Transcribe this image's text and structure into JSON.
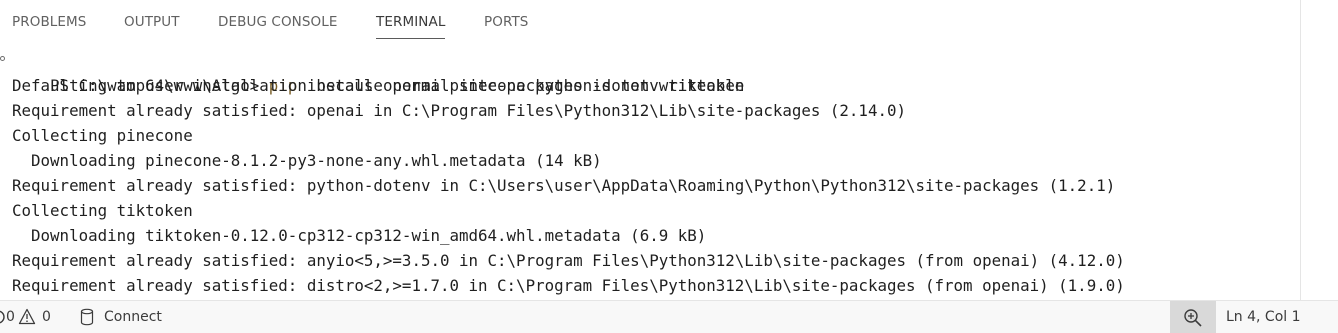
{
  "panel": {
    "tabs": [
      {
        "label": "PROBLEMS",
        "active": false
      },
      {
        "label": "OUTPUT",
        "active": false
      },
      {
        "label": "DEBUG CONSOLE",
        "active": false
      },
      {
        "label": "TERMINAL",
        "active": true
      },
      {
        "label": "PORTS",
        "active": false
      }
    ]
  },
  "terminal": {
    "prompt": "PS C:\\wamp64\\www\\Algo> ",
    "command_name": "pip",
    "command_args": " install openai pinecone python-dotenv tiktoken",
    "output": [
      "Defaulting to user installation because normal site-packages is not writeable",
      "Requirement already satisfied: openai in C:\\Program Files\\Python312\\Lib\\site-packages (2.14.0)",
      "Collecting pinecone",
      "  Downloading pinecone-8.1.2-py3-none-any.whl.metadata (14 kB)",
      "Requirement already satisfied: python-dotenv in C:\\Users\\user\\AppData\\Roaming\\Python\\Python312\\site-packages (1.2.1)",
      "Collecting tiktoken",
      "  Downloading tiktoken-0.12.0-cp312-cp312-win_amd64.whl.metadata (6.9 kB)",
      "Requirement already satisfied: anyio<5,>=3.5.0 in C:\\Program Files\\Python312\\Lib\\site-packages (from openai) (4.12.0)",
      "Requirement already satisfied: distro<2,>=1.7.0 in C:\\Program Files\\Python312\\Lib\\site-packages (from openai) (1.9.0)"
    ]
  },
  "status_bar": {
    "errors_count": "0",
    "warnings_count": "0",
    "connect_label": "Connect",
    "cursor_position": "Ln 4, Col 1",
    "icons": {
      "errors": "error-circle-icon",
      "warnings": "warning-triangle-icon",
      "connect": "database-icon",
      "zoom": "zoom-in-icon"
    }
  },
  "colors": {
    "command_highlight": "#795e26",
    "text": "#1f1f1f",
    "tab_inactive": "#616161",
    "status_bg": "#f8f8f8",
    "zoom_bg": "#d9d9d9"
  }
}
